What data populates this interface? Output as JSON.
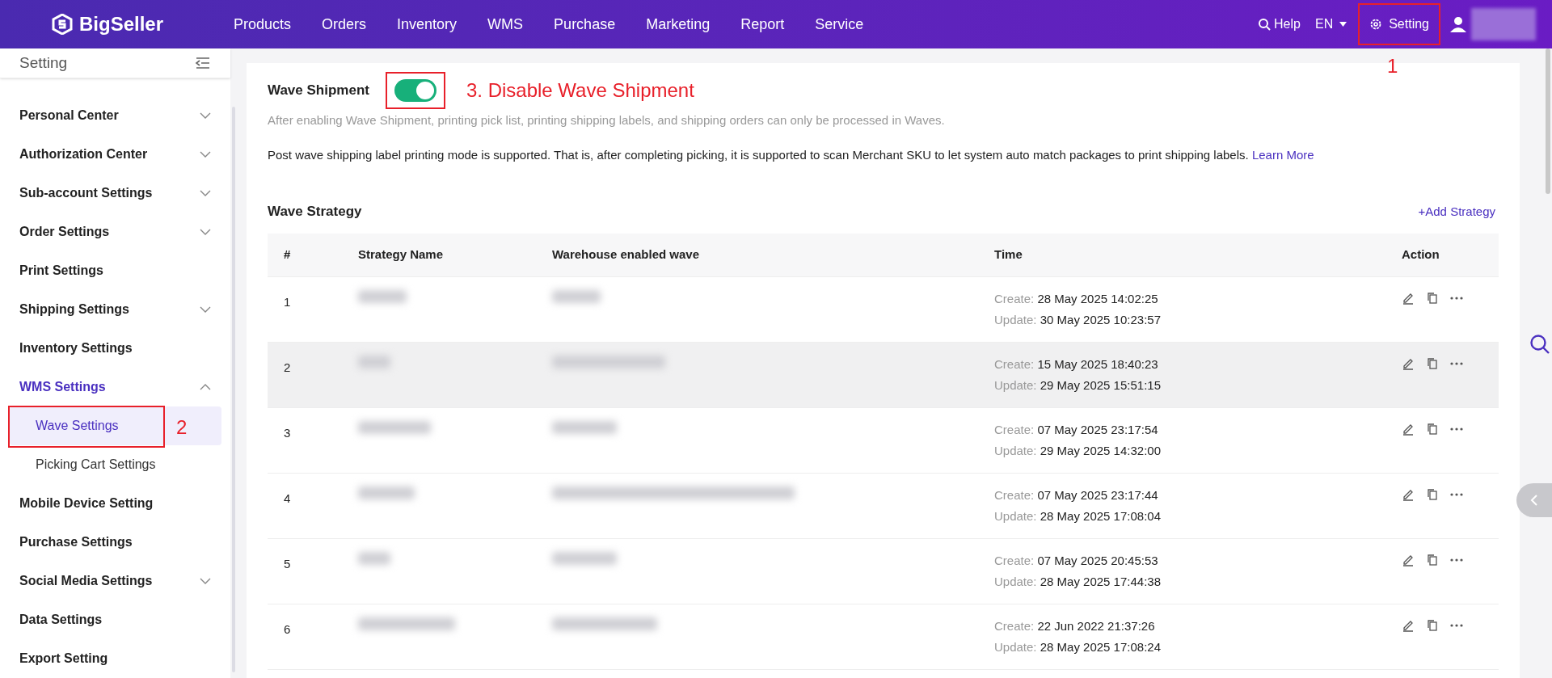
{
  "top_nav": {
    "logo": "BigSeller",
    "items": [
      {
        "label": "Products"
      },
      {
        "label": "Orders"
      },
      {
        "label": "Inventory"
      },
      {
        "label": "WMS"
      },
      {
        "label": "Purchase"
      },
      {
        "label": "Marketing"
      },
      {
        "label": "Report"
      },
      {
        "label": "Service"
      }
    ],
    "help": "Help",
    "language": "EN",
    "setting": "Setting"
  },
  "sidebar": {
    "title": "Setting",
    "items": [
      {
        "label": "Personal Center",
        "expanded": false,
        "selected": false
      },
      {
        "label": "Authorization Center",
        "expanded": false,
        "selected": false
      },
      {
        "label": "Sub-account Settings",
        "expanded": false,
        "selected": false
      },
      {
        "label": "Order Settings",
        "expanded": false,
        "selected": false
      },
      {
        "label": "Print Settings",
        "selected": false
      },
      {
        "label": "Shipping Settings",
        "expanded": false,
        "selected": false
      },
      {
        "label": "Inventory Settings",
        "selected": false
      },
      {
        "label": "WMS Settings",
        "expanded": true,
        "selected": true,
        "children": [
          {
            "label": "Wave Settings",
            "selected": true
          },
          {
            "label": "Picking Cart Settings",
            "selected": false
          }
        ]
      },
      {
        "label": "Mobile Device Setting",
        "selected": false
      },
      {
        "label": "Purchase Settings",
        "selected": false
      },
      {
        "label": "Social Media Settings",
        "expanded": false,
        "selected": false
      },
      {
        "label": "Data Settings",
        "selected": false
      },
      {
        "label": "Export Setting",
        "selected": false
      }
    ]
  },
  "wave_shipment": {
    "label": "Wave Shipment",
    "on": true,
    "hint": "After enabling Wave Shipment, printing pick list, printing shipping labels, and shipping orders can only be processed in Waves.",
    "note": "Post wave shipping label printing mode is supported. That is, after completing picking, it is supported to scan Merchant SKU to let system auto match packages to print shipping labels.",
    "link": "Learn More"
  },
  "wave_strategy": {
    "title": "Wave Strategy",
    "add": "+Add Strategy",
    "columns": [
      "#",
      "Strategy Name",
      "Warehouse enabled wave",
      "Time",
      "Action"
    ],
    "rows": [
      {
        "index": "1",
        "create_label": "Create:",
        "create": "28 May 2025 14:02:25",
        "update_label": "Update:",
        "update": "30 May 2025 10:23:57",
        "hovered": false
      },
      {
        "index": "2",
        "create_label": "Create:",
        "create": "15 May 2025 18:40:23",
        "update_label": "Update:",
        "update": "29 May 2025 15:51:15",
        "hovered": true
      },
      {
        "index": "3",
        "create_label": "Create:",
        "create": "07 May 2025 23:17:54",
        "update_label": "Update:",
        "update": "29 May 2025 14:32:00",
        "hovered": false
      },
      {
        "index": "4",
        "create_label": "Create:",
        "create": "07 May 2025 23:17:44",
        "update_label": "Update:",
        "update": "28 May 2025 17:08:04",
        "hovered": false
      },
      {
        "index": "5",
        "create_label": "Create:",
        "create": "07 May 2025 20:45:53",
        "update_label": "Update:",
        "update": "28 May 2025 17:44:38",
        "hovered": false
      },
      {
        "index": "6",
        "create_label": "Create:",
        "create": "22 Jun 2022 21:37:26",
        "update_label": "Update:",
        "update": "28 May 2025 17:08:24",
        "hovered": false
      }
    ]
  },
  "annotations": [
    "1",
    "2",
    "3. Disable Wave Shipment"
  ]
}
